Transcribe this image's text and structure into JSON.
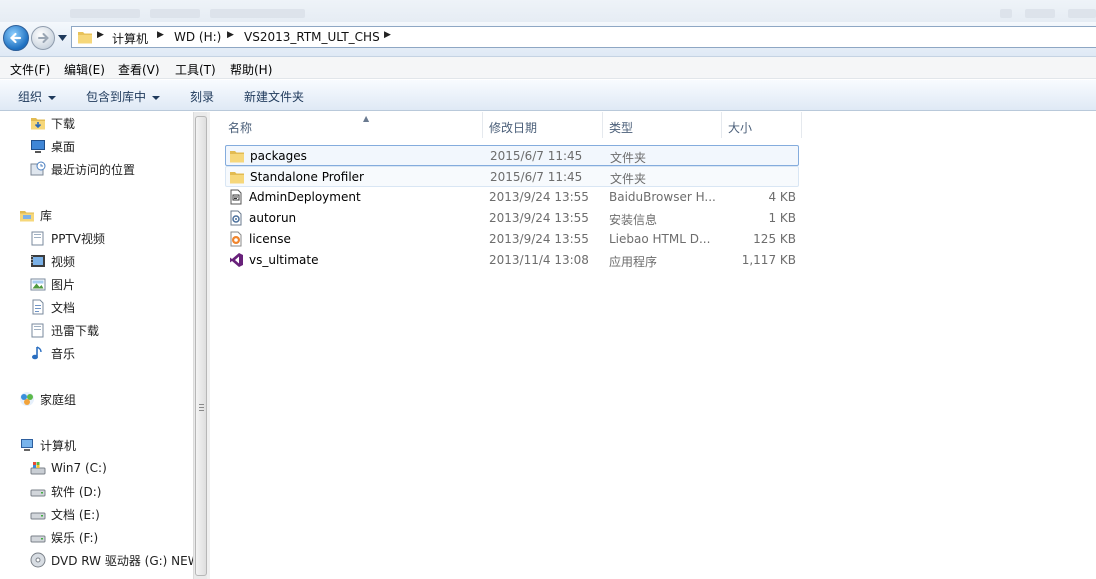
{
  "address": {
    "crumbs": [
      "计算机",
      "WD (H:)",
      "VS2013_RTM_ULT_CHS"
    ]
  },
  "menu": [
    "文件(F)",
    "编辑(E)",
    "查看(V)",
    "工具(T)",
    "帮助(H)"
  ],
  "toolbar": {
    "organize": "组织",
    "include_library": "包含到库中",
    "burn": "刻录",
    "new_folder": "新建文件夹"
  },
  "nav": {
    "favorites": [
      {
        "label": "下载",
        "icon": "downloads-folder-icon"
      },
      {
        "label": "桌面",
        "icon": "desktop-icon"
      },
      {
        "label": "最近访问的位置",
        "icon": "recent-places-icon"
      }
    ],
    "libraries_label": "库",
    "libraries": [
      {
        "label": "PPTV视频",
        "icon": "library-icon"
      },
      {
        "label": "视频",
        "icon": "video-library-icon"
      },
      {
        "label": "图片",
        "icon": "pictures-library-icon"
      },
      {
        "label": "文档",
        "icon": "documents-library-icon"
      },
      {
        "label": "迅雷下载",
        "icon": "library-icon"
      },
      {
        "label": "音乐",
        "icon": "music-library-icon"
      }
    ],
    "homegroup_label": "家庭组",
    "computer_label": "计算机",
    "drives": [
      {
        "label": "Win7 (C:)",
        "icon": "system-drive-icon"
      },
      {
        "label": "软件 (D:)",
        "icon": "drive-icon"
      },
      {
        "label": "文档 (E:)",
        "icon": "drive-icon"
      },
      {
        "label": "娱乐 (F:)",
        "icon": "drive-icon"
      },
      {
        "label": "DVD RW 驱动器 (G:) NEW",
        "icon": "dvd-drive-icon"
      }
    ]
  },
  "columns": {
    "name": "名称",
    "modified": "修改日期",
    "type": "类型",
    "size": "大小"
  },
  "files": [
    {
      "name": "packages",
      "modified": "2015/6/7 11:45",
      "type": "文件夹",
      "size": "",
      "icon": "folder-icon"
    },
    {
      "name": "Standalone Profiler",
      "modified": "2015/6/7 11:45",
      "type": "文件夹",
      "size": "",
      "icon": "folder-icon"
    },
    {
      "name": "AdminDeployment",
      "modified": "2013/9/24 13:55",
      "type": "BaiduBrowser H...",
      "size": "4 KB",
      "icon": "xml-file-icon"
    },
    {
      "name": "autorun",
      "modified": "2013/9/24 13:55",
      "type": "安装信息",
      "size": "1 KB",
      "icon": "setup-info-file-icon"
    },
    {
      "name": "license",
      "modified": "2013/9/24 13:55",
      "type": "Liebao HTML D...",
      "size": "125 KB",
      "icon": "html-file-icon"
    },
    {
      "name": "vs_ultimate",
      "modified": "2013/11/4 13:08",
      "type": "应用程序",
      "size": "1,117 KB",
      "icon": "visual-studio-icon"
    }
  ]
}
